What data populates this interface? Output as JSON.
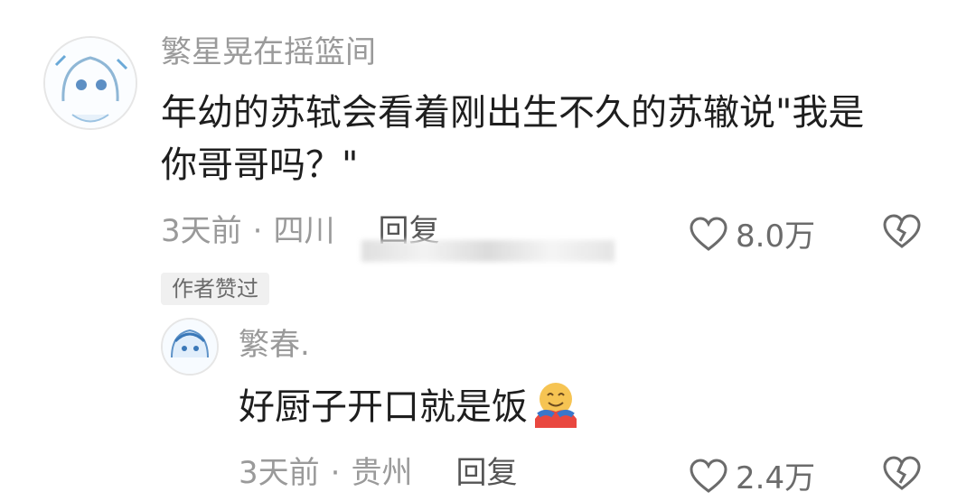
{
  "comment": {
    "username": "繁星晃在摇篮间",
    "text_line1": "年幼的苏轼会看着刚出生不久的苏辙说\"我是",
    "text_line2": "你哥哥吗？\"",
    "time": "3天前",
    "location": "四川",
    "reply_label": "回复",
    "like_count": "8.0万",
    "icons": {
      "like": "heart-icon",
      "dislike": "broken-heart-icon"
    },
    "badge": "作者赞过"
  },
  "reply": {
    "username": "繁春.",
    "text": "好厨子开口就是饭",
    "emoji": "hugging-face-emoji",
    "time": "3天前",
    "location": "贵州",
    "reply_label": "回复",
    "like_count": "2.4万",
    "icons": {
      "like": "heart-icon",
      "dislike": "broken-heart-icon"
    }
  },
  "colors": {
    "username": "#9a9a9a",
    "content": "#1e1e1e",
    "badge_bg": "#f0f0f0"
  }
}
